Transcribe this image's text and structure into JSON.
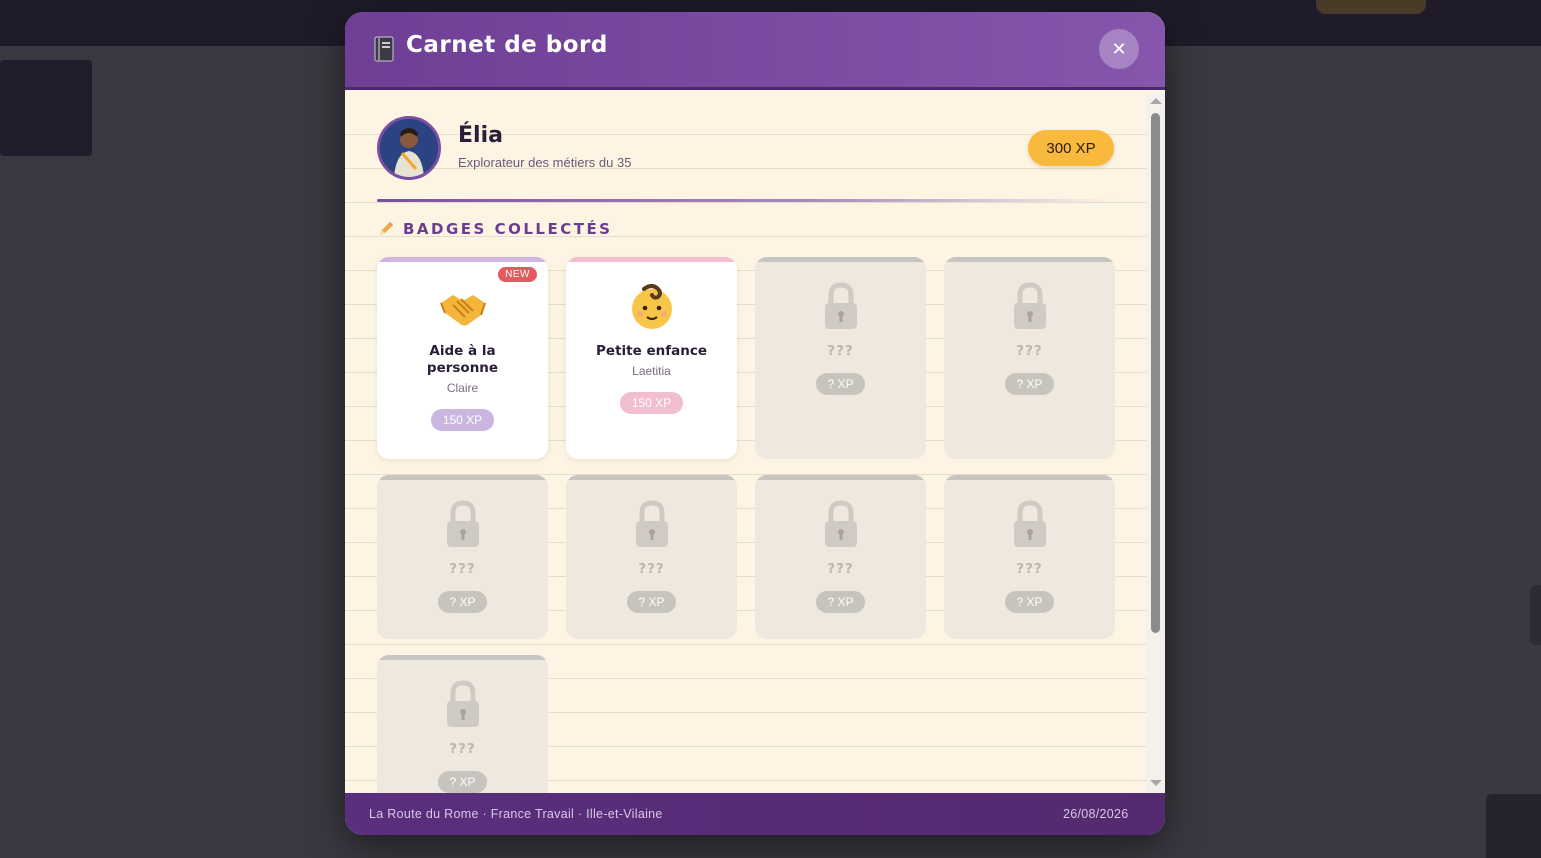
{
  "modal": {
    "title": "Carnet de bord",
    "close_label": "✕",
    "header_icon": "notebook-icon"
  },
  "profile": {
    "name": "Élia",
    "subtitle": "Explorateur des métiers du 35",
    "xp": "300 XP"
  },
  "badges_section": {
    "title": "BADGES COLLECTÉS",
    "icon": "pencil-icon"
  },
  "badges": [
    {
      "title": "Aide à la personne",
      "person": "Claire",
      "xp": "150 XP",
      "new_label": "NEW",
      "icon": "handshake-icon",
      "accent": "#cdb7e0",
      "xp_color": "#cbb6df"
    },
    {
      "title": "Petite enfance",
      "person": "Laetitia",
      "xp": "150 XP",
      "icon": "baby-icon",
      "accent": "#f2bed0",
      "xp_color": "#f1bdd0"
    },
    {
      "title": "???",
      "xp": "? XP",
      "icon": "lock-icon"
    },
    {
      "title": "???",
      "xp": "? XP",
      "icon": "lock-icon"
    },
    {
      "title": "???",
      "xp": "? XP",
      "icon": "lock-icon"
    },
    {
      "title": "???",
      "xp": "? XP",
      "icon": "lock-icon"
    },
    {
      "title": "???",
      "xp": "? XP",
      "icon": "lock-icon"
    },
    {
      "title": "???",
      "xp": "? XP",
      "icon": "lock-icon"
    },
    {
      "title": "???",
      "xp": "? XP",
      "icon": "lock-icon"
    }
  ],
  "footer": {
    "left": "La Route du Rome · France Travail · Ille-et-Vilaine",
    "date": "26/08/2026"
  },
  "colors": {
    "header": "#7b4ca3",
    "xp_pill": "#f9b93c",
    "new_badge": "#e35b5f",
    "paper": "#fdf4e3"
  }
}
